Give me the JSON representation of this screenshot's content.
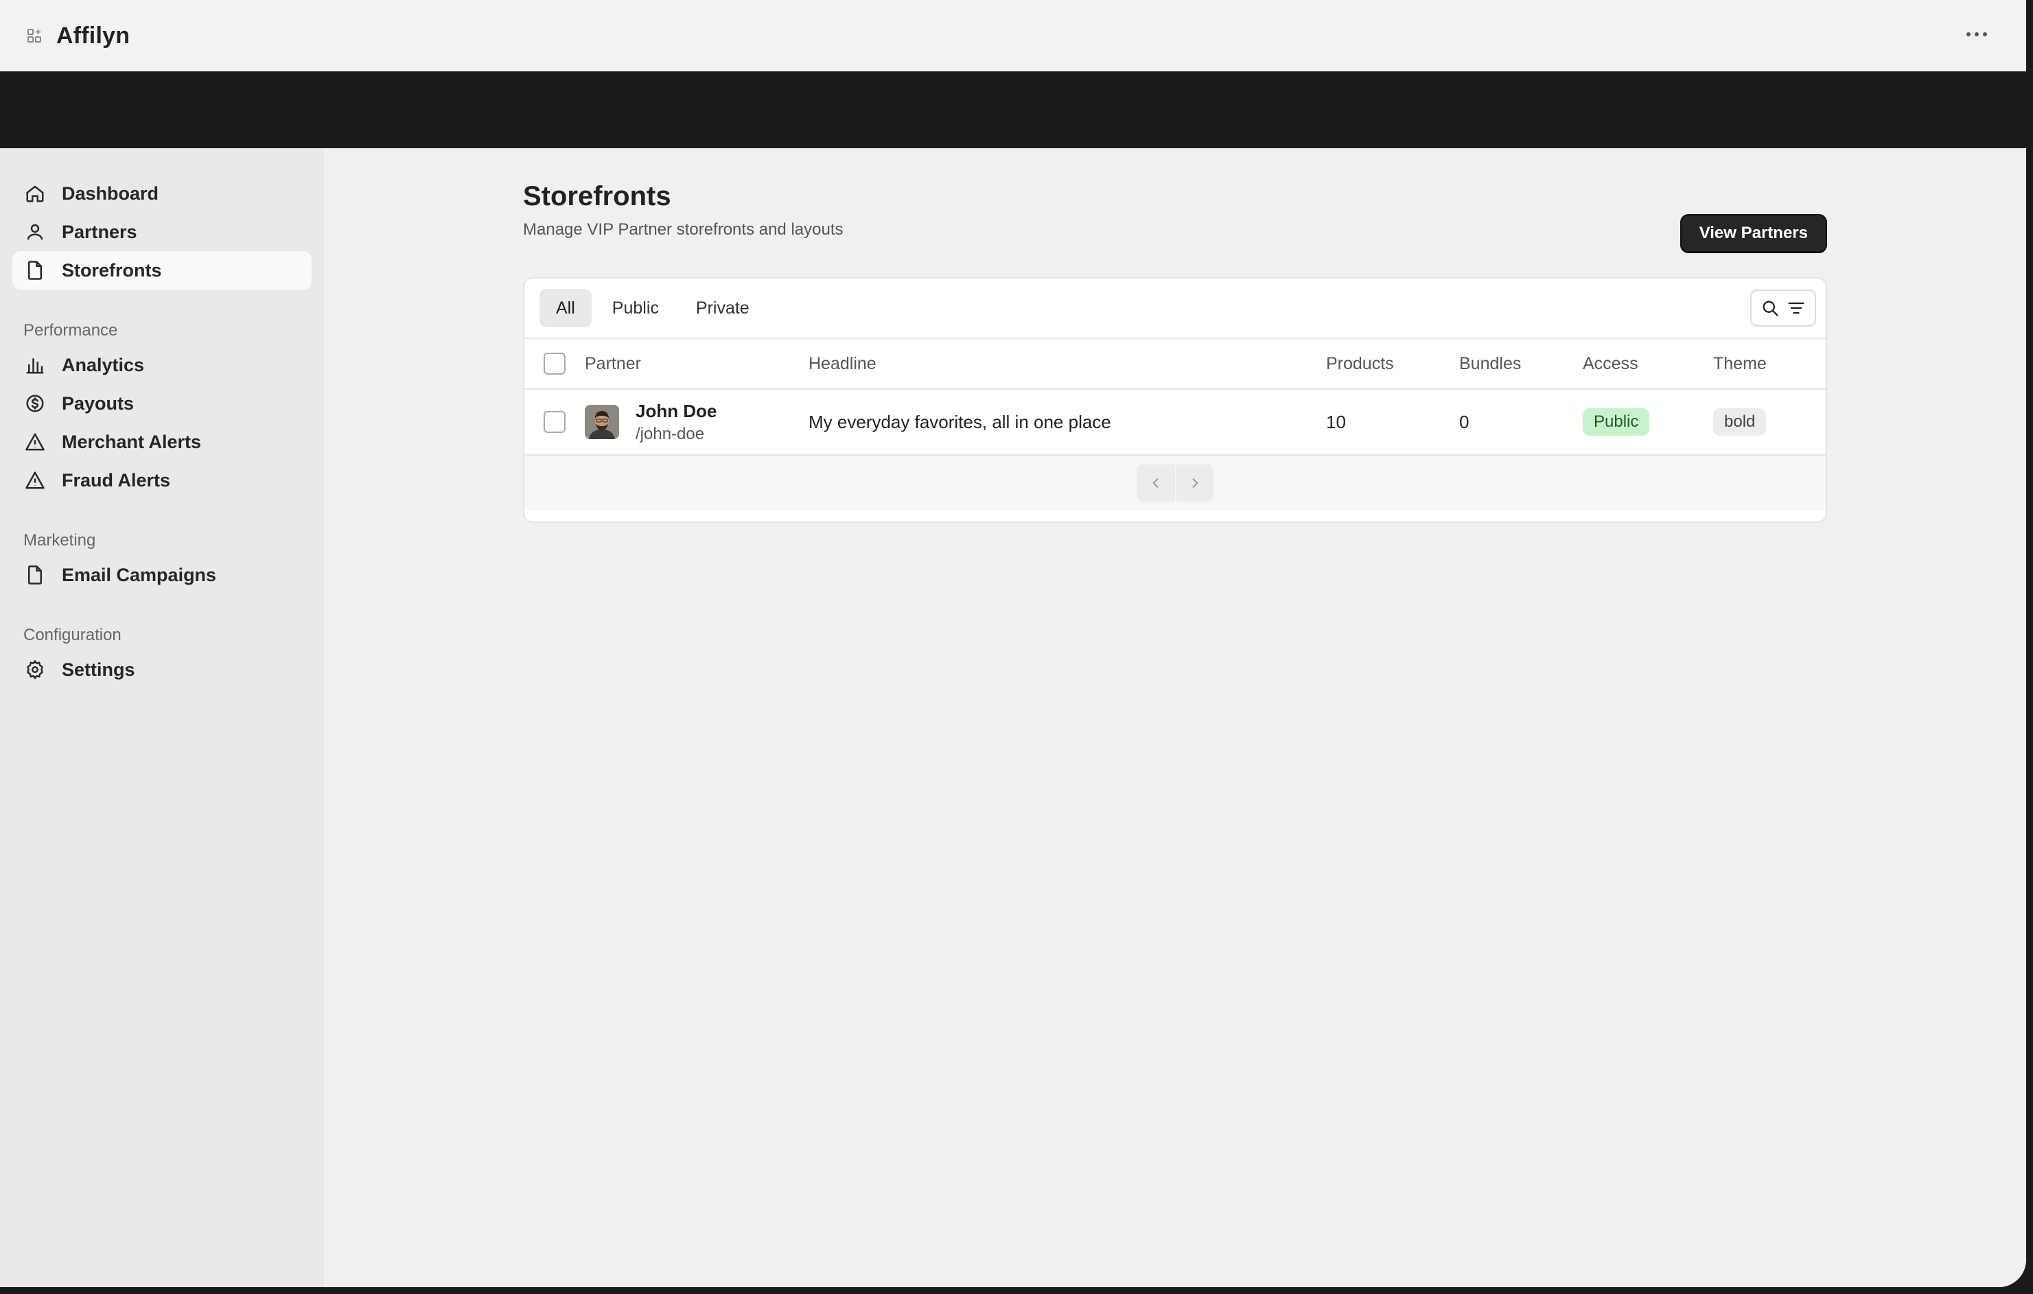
{
  "app": {
    "title": "Affilyn"
  },
  "sidebar": {
    "items": [
      {
        "label": "Dashboard",
        "icon": "home-icon"
      },
      {
        "label": "Partners",
        "icon": "user-icon"
      },
      {
        "label": "Storefronts",
        "icon": "file-icon",
        "active": true
      }
    ],
    "groups": [
      {
        "label": "Performance",
        "items": [
          {
            "label": "Analytics",
            "icon": "bar-chart-icon"
          },
          {
            "label": "Payouts",
            "icon": "dollar-circle-icon"
          },
          {
            "label": "Merchant Alerts",
            "icon": "warning-icon"
          },
          {
            "label": "Fraud Alerts",
            "icon": "warning-icon"
          }
        ]
      },
      {
        "label": "Marketing",
        "items": [
          {
            "label": "Email Campaigns",
            "icon": "file-icon"
          }
        ]
      },
      {
        "label": "Configuration",
        "items": [
          {
            "label": "Settings",
            "icon": "gear-icon"
          }
        ]
      }
    ]
  },
  "page": {
    "title": "Storefronts",
    "subtitle": "Manage VIP Partner storefronts and layouts",
    "primary_action": "View Partners"
  },
  "tabs": [
    {
      "label": "All",
      "active": true
    },
    {
      "label": "Public"
    },
    {
      "label": "Private"
    }
  ],
  "table": {
    "columns": [
      "Partner",
      "Headline",
      "Products",
      "Bundles",
      "Access",
      "Theme"
    ],
    "rows": [
      {
        "name": "John Doe",
        "slug": "/john-doe",
        "headline": "My everyday favorites, all in one place",
        "products": "10",
        "bundles": "0",
        "access": "Public",
        "theme": "bold"
      }
    ]
  },
  "colors": {
    "banner": "#1b1b1b",
    "sidebar_bg": "#e9e9e9",
    "primary_button": "#262626",
    "badge_public_bg": "#c8f2cc",
    "badge_public_text": "#1b5e20"
  }
}
